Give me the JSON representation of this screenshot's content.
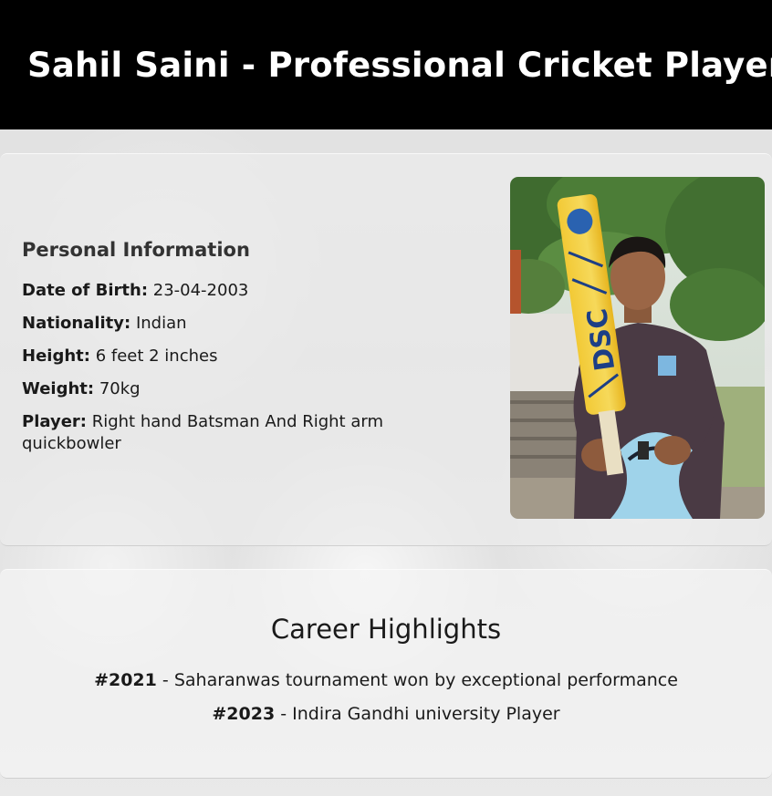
{
  "page_title": "Sahil Saini - Professional Cricket Player",
  "personal": {
    "heading": "Personal Information",
    "fields": [
      {
        "label": "Date of Birth:",
        "value": "23-04-2003"
      },
      {
        "label": "Nationality:",
        "value": "Indian"
      },
      {
        "label": "Height:",
        "value": "6 feet 2 inches"
      },
      {
        "label": "Weight:",
        "value": "70kg"
      },
      {
        "label": "Player:",
        "value": "Right hand Batsman And Right arm quickbowler"
      }
    ]
  },
  "photo": {
    "bat_brand": "DSC"
  },
  "career": {
    "heading": "Career Highlights",
    "items": [
      {
        "year": "#2021",
        "text": "- Saharanwas tournament won by exceptional performance"
      },
      {
        "year": "#2023",
        "text": "- Indira Gandhi university Player"
      }
    ]
  },
  "colors": {
    "header_bg": "#000000",
    "header_text": "#ffffff",
    "page_bg": "#e6e6e6"
  }
}
